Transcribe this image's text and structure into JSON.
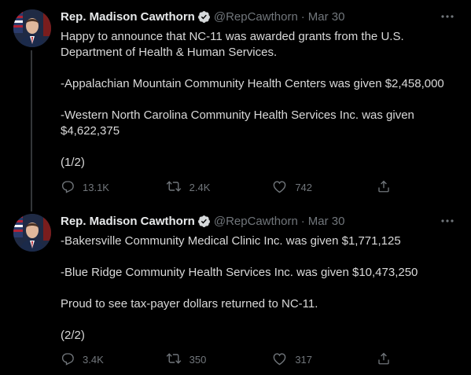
{
  "tweets": [
    {
      "author_name": "Rep. Madison Cawthorn",
      "handle": "@RepCawthorn",
      "separator": "·",
      "date": "Mar 30",
      "lines": [
        "Happy to announce that NC-11 was awarded grants from the U.S.",
        "Department of Health & Human Services.",
        "",
        "-Appalachian Mountain Community Health Centers was given $2,458,000",
        "",
        "-Western North Carolina Community Health Services Inc. was given",
        "$4,622,375",
        "",
        "(1/2)"
      ],
      "replies": "13.1K",
      "retweets": "2.4K",
      "likes": "742"
    },
    {
      "author_name": "Rep. Madison Cawthorn",
      "handle": "@RepCawthorn",
      "separator": "·",
      "date": "Mar 30",
      "lines": [
        "-Bakersville Community Medical Clinic Inc. was given $1,771,125",
        "",
        "-Blue Ridge Community Health Services Inc. was given $10,473,250",
        "",
        "Proud to see tax-payer dollars returned to NC-11.",
        "",
        "(2/2)"
      ],
      "replies": "3.4K",
      "retweets": "350",
      "likes": "317"
    }
  ],
  "icons": {
    "verified": "verified-badge-icon",
    "more": "more-icon",
    "reply": "reply-icon",
    "retweet": "retweet-icon",
    "like": "heart-icon",
    "share": "share-icon"
  },
  "colors": {
    "background": "#000000",
    "name": "#e7e9ea",
    "text": "#d9d9d9",
    "muted": "#71767b",
    "thread_line": "#333639"
  }
}
